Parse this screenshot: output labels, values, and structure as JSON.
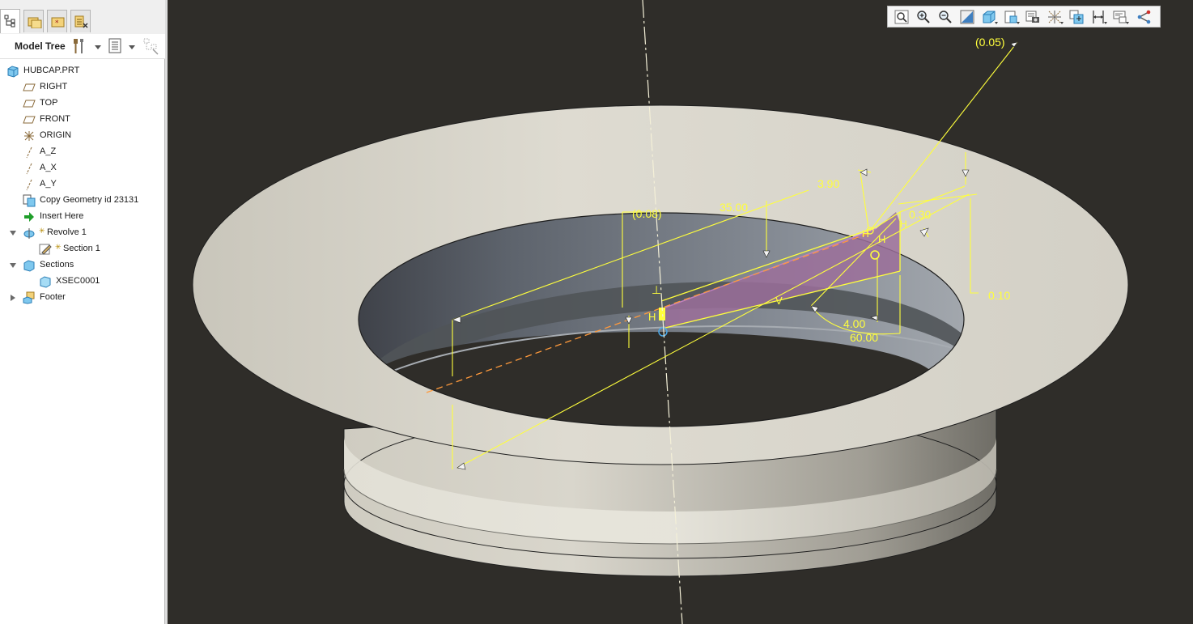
{
  "panel": {
    "tabs": [
      {
        "name": "model-tree-tab-icon",
        "active": true
      },
      {
        "name": "folder-browser-tab-icon",
        "active": false
      },
      {
        "name": "favorites-tab-icon",
        "active": false
      },
      {
        "name": "layers-tab-icon",
        "active": false
      }
    ],
    "tree_title": "Model Tree"
  },
  "tree": {
    "items": [
      {
        "label": "HUBCAP.PRT",
        "icon": "part-icon"
      },
      {
        "label": "RIGHT",
        "icon": "datum-plane-icon"
      },
      {
        "label": "TOP",
        "icon": "datum-plane-icon"
      },
      {
        "label": "FRONT",
        "icon": "datum-plane-icon"
      },
      {
        "label": "ORIGIN",
        "icon": "csys-icon"
      },
      {
        "label": "A_Z",
        "icon": "datum-axis-icon"
      },
      {
        "label": "A_X",
        "icon": "datum-axis-icon"
      },
      {
        "label": "A_Y",
        "icon": "datum-axis-icon"
      },
      {
        "label": "Copy Geometry id 23131",
        "icon": "copy-geometry-icon"
      },
      {
        "label": "Insert Here",
        "icon": "insert-arrow-icon"
      },
      {
        "label": "Revolve 1",
        "icon": "revolve-icon"
      },
      {
        "label": "Section 1",
        "icon": "sketch-icon"
      },
      {
        "label": "Sections",
        "icon": "sections-icon"
      },
      {
        "label": "XSEC0001",
        "icon": "xsec-icon"
      },
      {
        "label": "Footer",
        "icon": "footer-icon"
      }
    ]
  },
  "view_toolbar": {
    "buttons": [
      "refit-icon",
      "zoom-in-icon",
      "zoom-out-icon",
      "repaint-icon",
      "display-style-icon",
      "saved-views-icon",
      "view-manager-icon",
      "datum-display-icon",
      "spin-center-icon",
      "annotation-display-icon",
      "sketcher-display-icon",
      "section-display-icon"
    ]
  },
  "dimensions": {
    "d1": "(0.05)",
    "d2": "3.90",
    "d3": "35.00",
    "d4": "(0.08)",
    "d5": "0.30",
    "d6": "0.10",
    "d7": "4.00",
    "d8": "60.00"
  },
  "constraints": {
    "h1": "H",
    "h2": "H",
    "h3": "H",
    "h4": "H",
    "v1": "V",
    "perp": "⊥"
  },
  "colors": {
    "viewport_bg": "#2f2d29",
    "dimension": "#ffff3c",
    "section_fill": "#9b6f9a"
  }
}
